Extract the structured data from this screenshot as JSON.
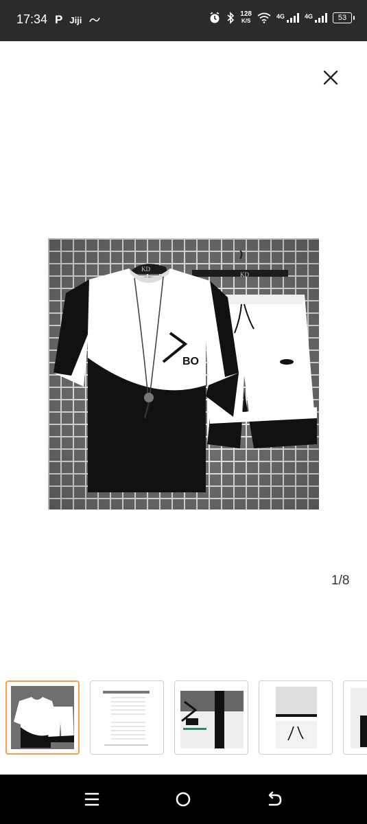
{
  "status_bar": {
    "time": "17:34",
    "left_icons": [
      "P",
      "Jiji"
    ],
    "net_speed_value": "128",
    "net_speed_unit": "K/S",
    "signal1_label": "4G",
    "signal2_label": "4G",
    "battery": "53"
  },
  "gallery": {
    "image_hanger_label": "KD",
    "shirt_logo_text": "BO",
    "page_current": "1",
    "page_separator": "/",
    "page_total": "8"
  },
  "thumbnails": [
    {
      "name": "outfit-front",
      "active": true
    },
    {
      "name": "size-chart",
      "active": false
    },
    {
      "name": "shirt-detail",
      "active": false
    },
    {
      "name": "shorts-detail",
      "active": false
    },
    {
      "name": "side-detail",
      "active": false
    }
  ],
  "nav": {
    "icons": [
      "menu-icon",
      "home-icon",
      "back-icon"
    ]
  },
  "colors": {
    "status_bar_bg": "#2b2b2b",
    "active_thumb_border": "#f3a04a",
    "nav_bar_bg": "#000000"
  }
}
